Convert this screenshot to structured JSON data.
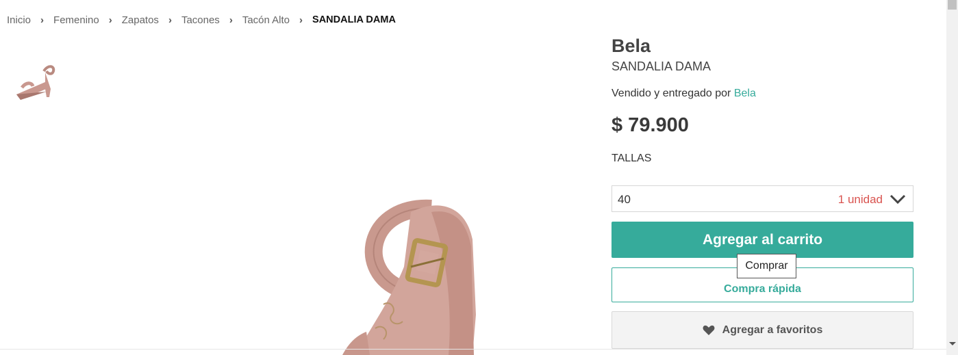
{
  "breadcrumb": {
    "items": [
      "Inicio",
      "Femenino",
      "Zapatos",
      "Tacones",
      "Tacón Alto"
    ],
    "current": "SANDALIA DAMA",
    "separator": "›"
  },
  "product": {
    "brand": "Bela",
    "name": "SANDALIA DAMA",
    "seller_prefix": "Vendido y entregado por",
    "seller_name": "Bela",
    "price": "$ 79.900",
    "sizes_label": "TALLAS",
    "selected_size": "40",
    "stock": "1 unidad"
  },
  "actions": {
    "add_to_cart": "Agregar al carrito",
    "quick_buy": "Compra rápida",
    "tooltip": "Comprar",
    "add_to_favorites": "Agregar a favoritos"
  },
  "colors": {
    "accent": "#36ab9b",
    "stock": "#d9534f",
    "product": "#c9988f"
  },
  "icons": {
    "chevron": "chevron-down-icon",
    "heart": "heart-icon"
  }
}
